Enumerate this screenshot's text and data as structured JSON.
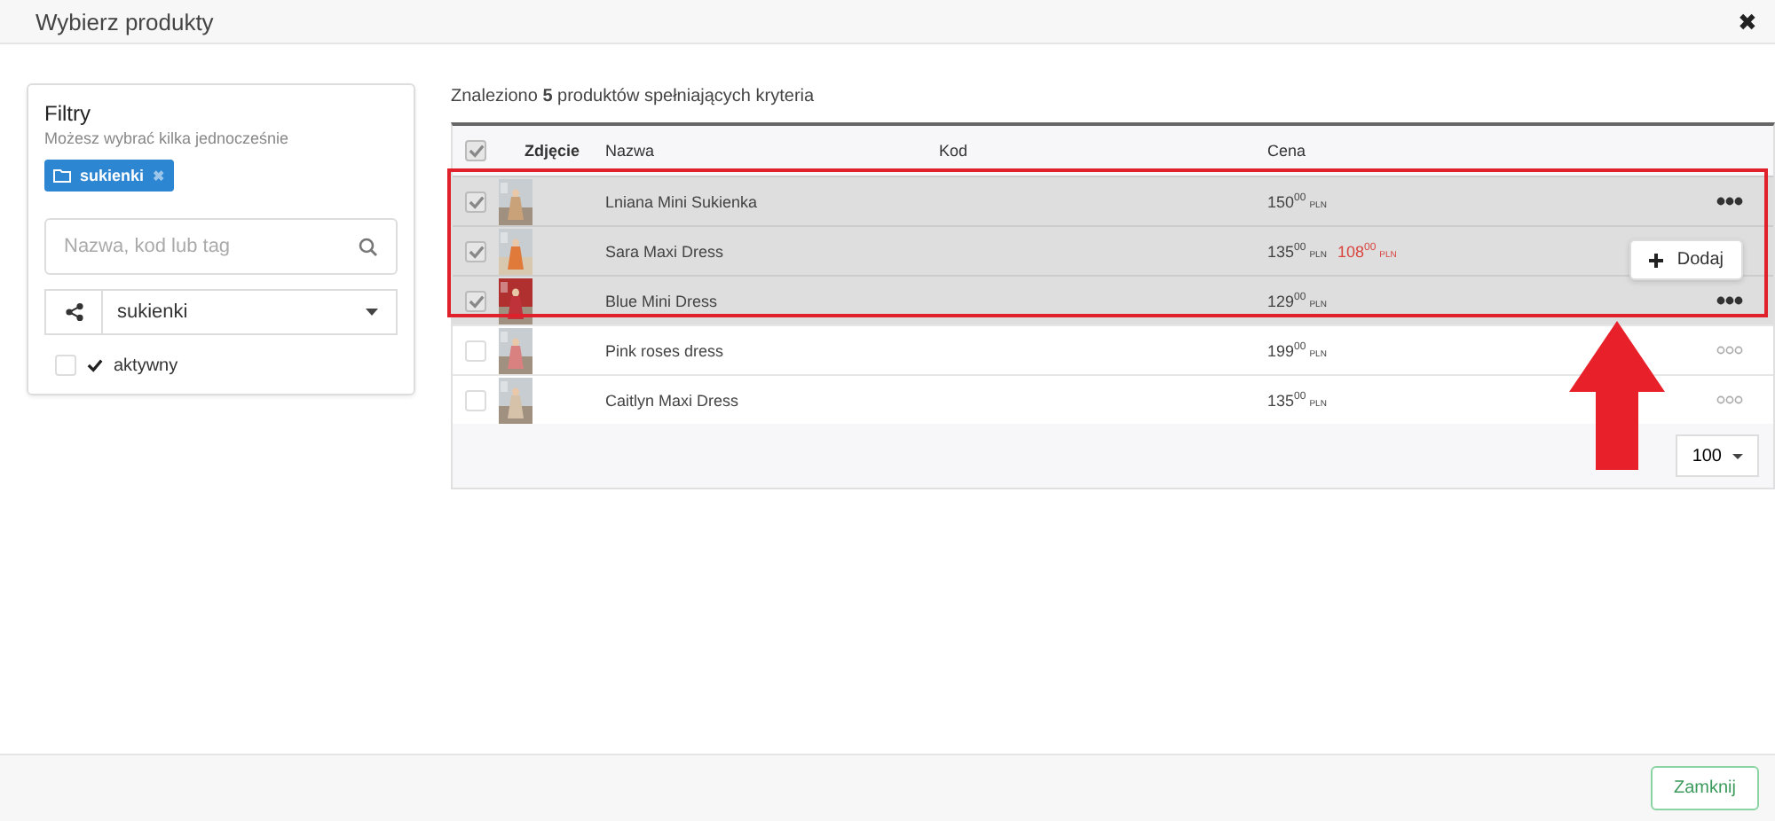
{
  "window": {
    "title": "Wybierz produkty",
    "close": "✖"
  },
  "filters": {
    "title": "Filtry",
    "hint": "Możesz wybrać kilka jednocześnie",
    "tags": [
      {
        "label": "sukienki",
        "remove": "✖"
      }
    ],
    "search": {
      "placeholder": "Nazwa, kod lub tag"
    },
    "category": {
      "value": "sukienki"
    },
    "active": {
      "label": "aktywny",
      "checked": false
    }
  },
  "results": {
    "summary": "Znaleziono **5** produktów spełniających kryteria"
  },
  "table": {
    "all_checked": true,
    "columns": [
      "Zdjęcie",
      "Nazwa",
      "Kod",
      "Cena"
    ],
    "rows": [
      {
        "name": "Lniana Mini Sukienka",
        "price": "150",
        "decimals": "00",
        "currency": "PLN",
        "checked": true,
        "menu_open": false
      },
      {
        "name": "Sara Maxi Dress",
        "price": "135",
        "decimals": "00",
        "currency": "PLN",
        "sale": {
          "price": "108",
          "decimals": "00",
          "currency": "PLN"
        },
        "checked": true,
        "menu_open": true
      },
      {
        "name": "Blue Mini Dress",
        "price": "129",
        "decimals": "00",
        "currency": "PLN",
        "checked": true,
        "menu_open": false
      },
      {
        "name": "Pink roses dress",
        "price": "199",
        "decimals": "00",
        "currency": "PLN",
        "checked": false,
        "menu_open": false
      },
      {
        "name": "Caitlyn Maxi Dress",
        "price": "135",
        "decimals": "00",
        "currency": "PLN",
        "checked": false,
        "menu_open": false
      }
    ],
    "row_menu": {
      "action": "Dodaj"
    },
    "page_size": "100"
  },
  "footer": {
    "close_button": "Zamknij"
  }
}
